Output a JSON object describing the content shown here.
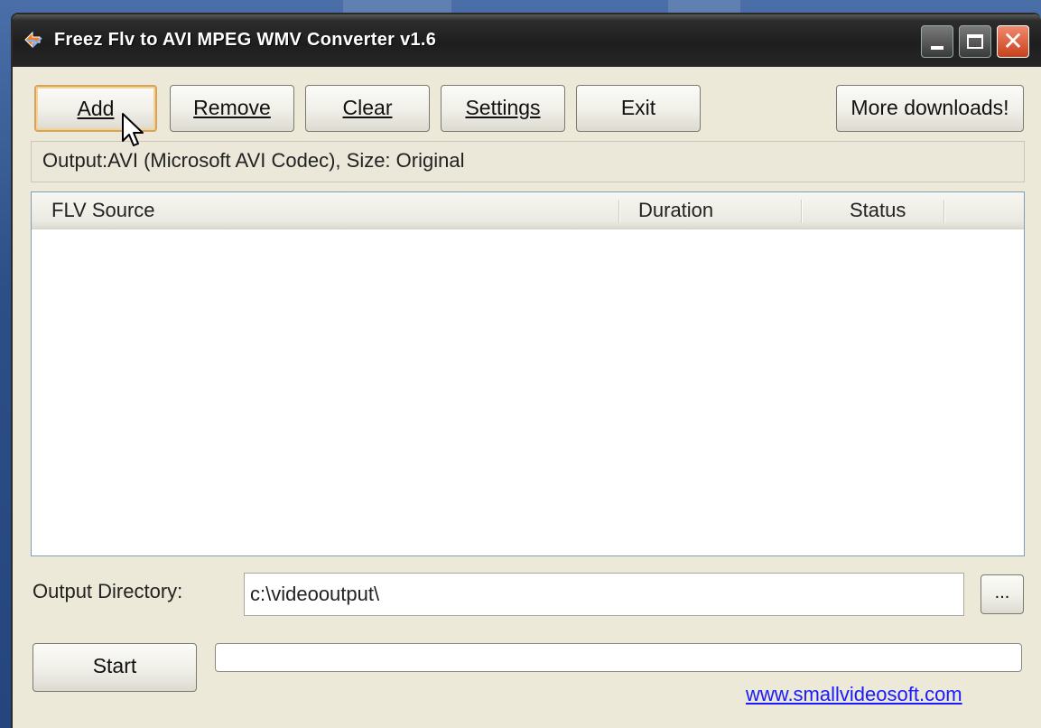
{
  "window": {
    "title": "Freez Flv to AVI MPEG WMV Converter v1.6"
  },
  "toolbar": {
    "add": "Add",
    "remove": "Remove",
    "clear": "Clear",
    "settings": "Settings",
    "exit": "Exit",
    "more_downloads": "More downloads!"
  },
  "output_info": "Output:AVI (Microsoft AVI Codec), Size: Original",
  "file_list": {
    "columns": [
      "FLV Source",
      "Duration",
      "Status"
    ],
    "rows": []
  },
  "output_directory": {
    "label": "Output Directory:",
    "value": "c:\\videooutput\\",
    "browse_label": "..."
  },
  "start_label": "Start",
  "progress": 0,
  "website_link": "www.smallvideosoft.com",
  "colors": {
    "titlebar": "#262626",
    "window_bg": "#ece9d8",
    "close_button": "#d9532b",
    "link": "#1a1aff",
    "focus_border": "#d5a35e"
  },
  "icons": [
    "app-icon",
    "minimize-icon",
    "maximize-icon",
    "close-icon",
    "mouse-cursor-icon"
  ]
}
